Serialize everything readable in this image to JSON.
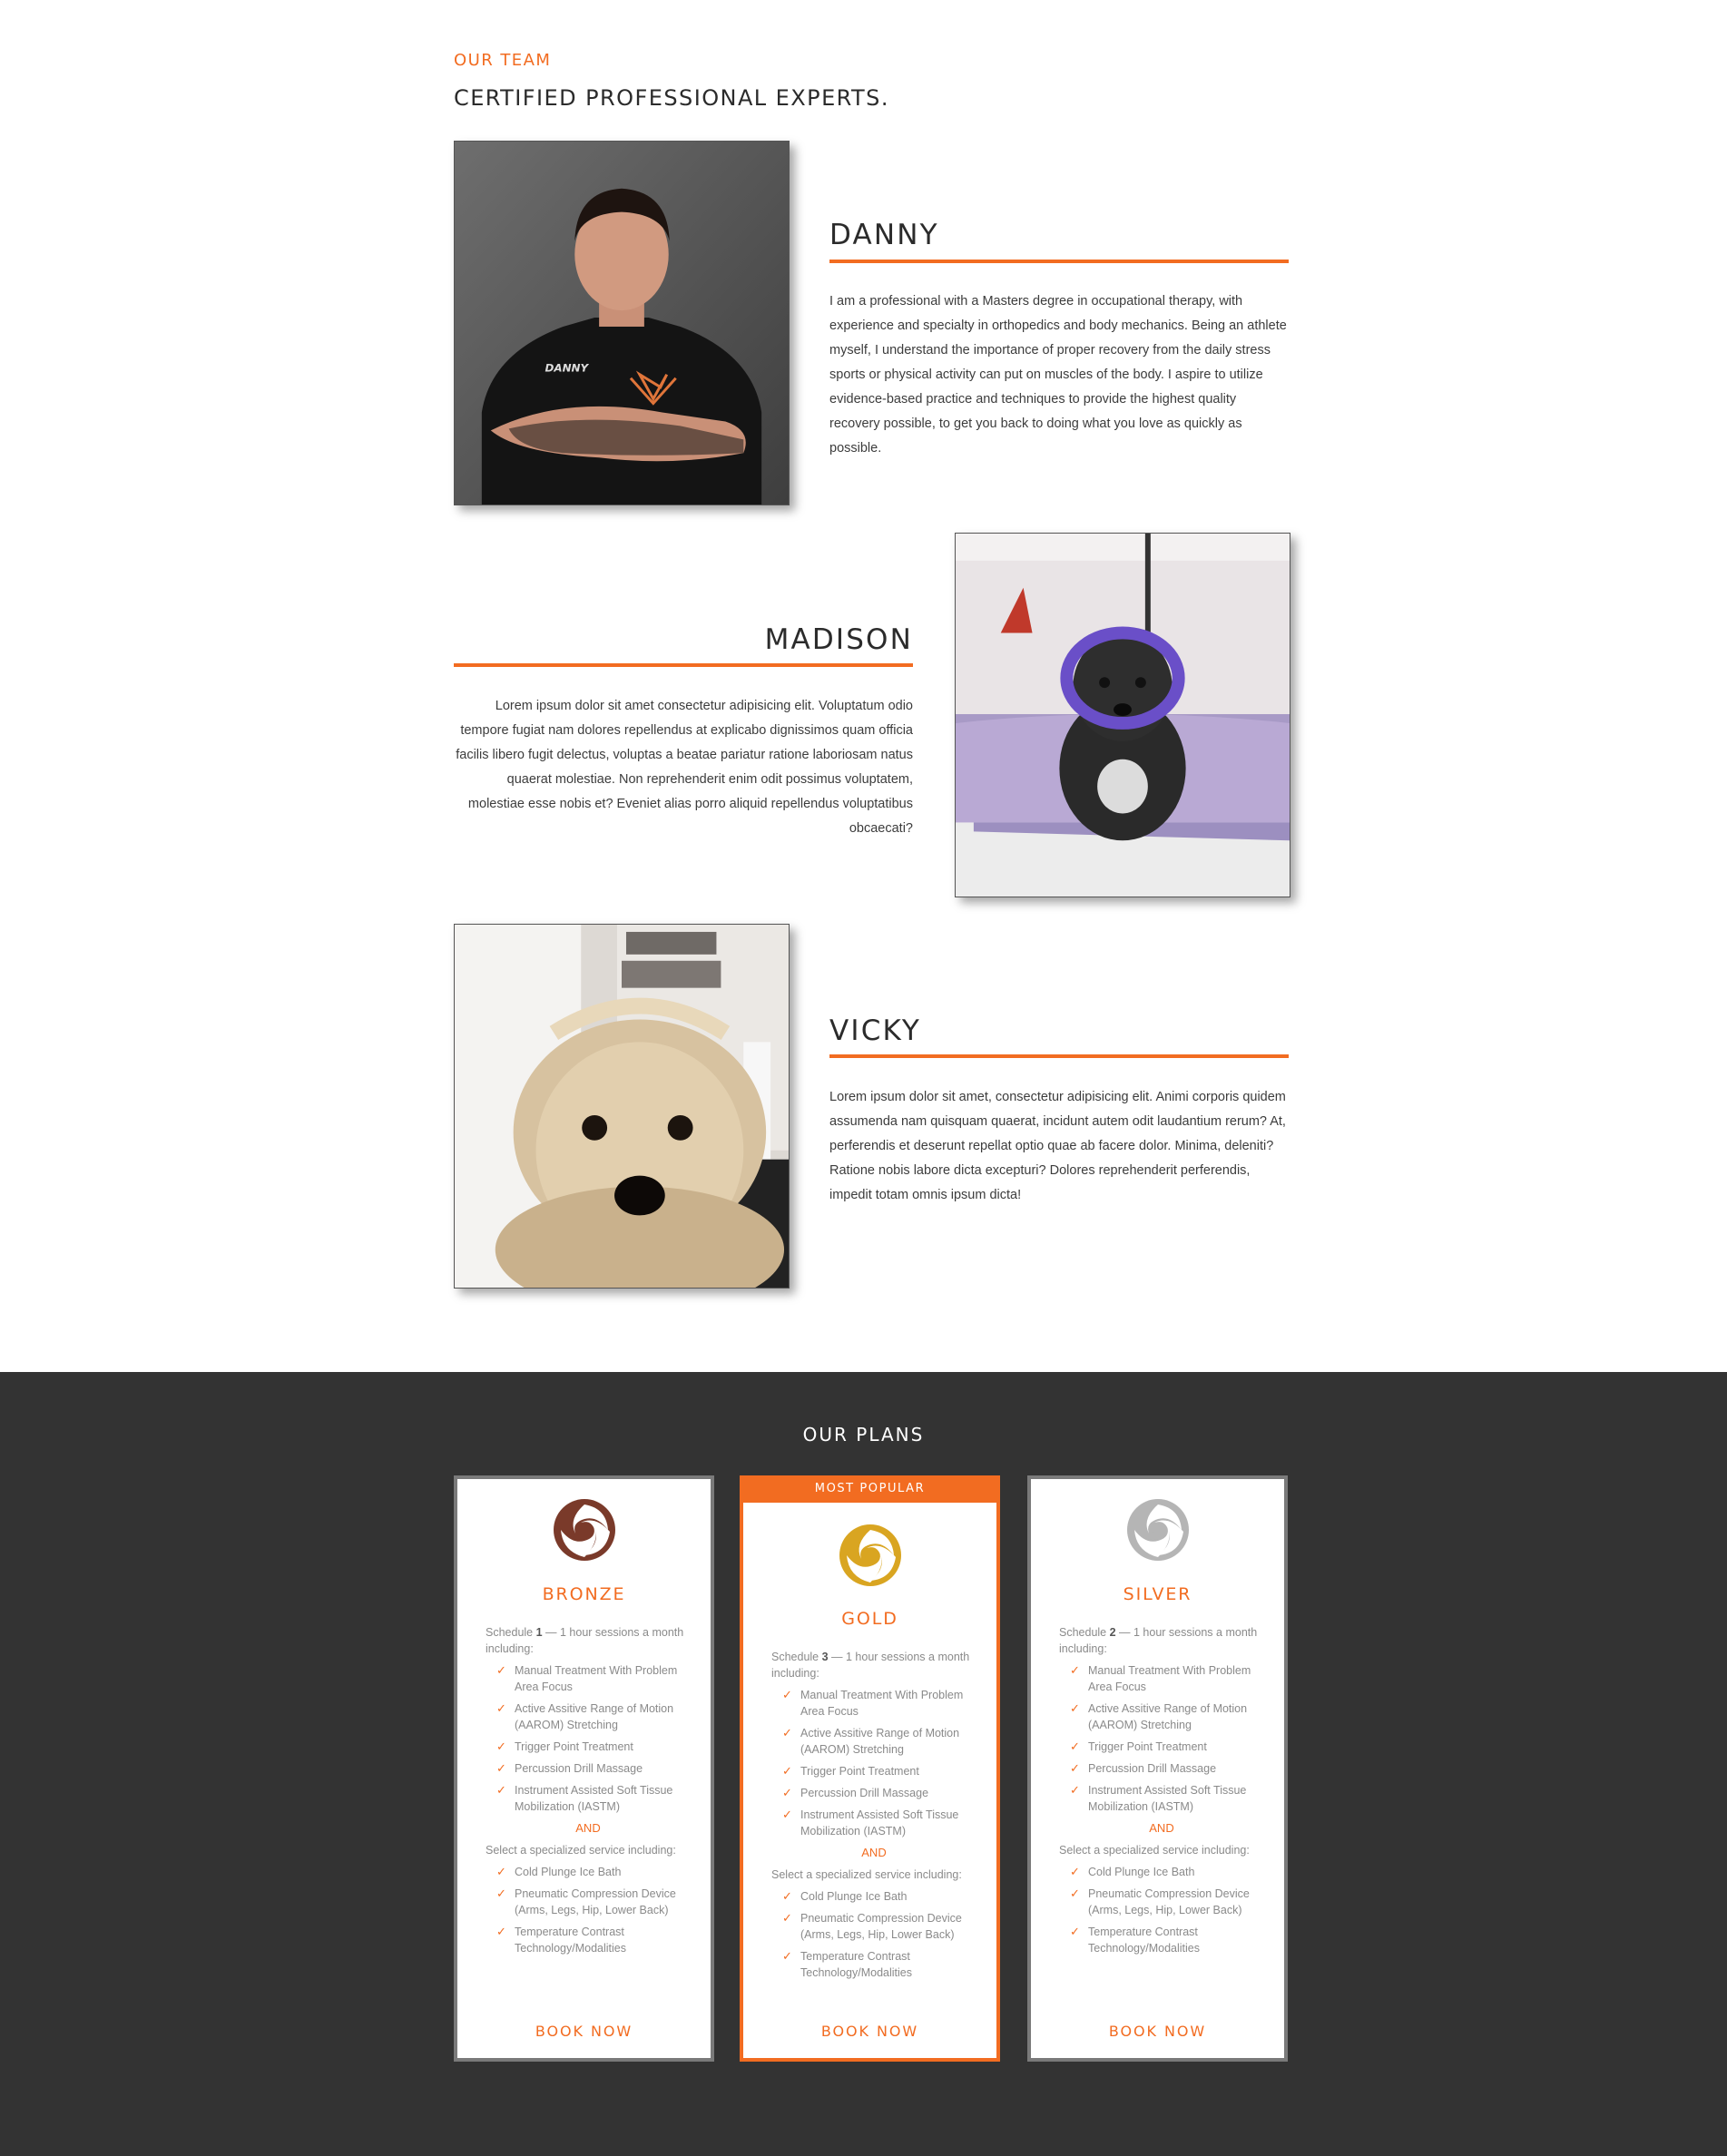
{
  "team": {
    "eyebrow": "OUR TEAM",
    "title": "CERTIFIED PROFESSIONAL EXPERTS.",
    "members": [
      {
        "name": "DANNY",
        "shirt_text": "DANNY",
        "bio": "I am a professional with a Masters degree in occupational therapy, with experience and specialty in orthopedics and body mechanics. Being an athlete myself, I understand the importance of proper recovery from the daily stress sports or physical activity can put on muscles of the body. I aspire to utilize evidence-based practice and techniques to provide the highest quality recovery possible, to get you back to doing what you love as quickly as possible."
      },
      {
        "name": "MADISON",
        "bio": "Lorem ipsum dolor sit amet consectetur adipisicing elit. Voluptatum odio tempore fugiat nam dolores repellendus at explicabo dignissimos quam officia facilis libero fugit delectus, voluptas a beatae pariatur ratione laboriosam natus quaerat molestiae. Non reprehenderit enim odit possimus voluptatem, molestiae esse nobis et? Eveniet alias porro aliquid repellendus voluptatibus obcaecati?"
      },
      {
        "name": "VICKY",
        "bio": "Lorem ipsum dolor sit amet, consectetur adipisicing elit. Animi corporis quidem assumenda nam quisquam quaerat, incidunt autem odit laudantium rerum? At, perferendis et deserunt repellat optio quae ab facere dolor. Minima, deleniti? Ratione nobis labore dicta excepturi? Dolores reprehenderit perferendis, impedit totam omnis ipsum dicta!"
      }
    ]
  },
  "plans": {
    "title": "OUR PLANS",
    "popular_label": "MOST POPULAR",
    "and_label": "AND",
    "select_label": "Select a specialized service including:",
    "book_label": "BOOK NOW",
    "schedule_prefix": "Schedule ",
    "schedule_suffix": " — 1 hour sessions a month including:",
    "colors": {
      "accent": "#f26c21",
      "bronze": "#7a3a2a",
      "gold": "#d9a521",
      "silver": "#b5b5b5",
      "dark_bg": "#333333"
    },
    "cards": [
      {
        "name": "BRONZE",
        "sessions": "1",
        "features": [
          "Manual Treatment With Problem Area Focus",
          "Active Assitive Range of Motion (AAROM) Stretching",
          "Trigger Point Treatment",
          "Percussion Drill Massage",
          "Instrument Assisted Soft Tissue Mobilization (IASTM)"
        ],
        "specials": [
          "Cold Plunge Ice Bath",
          "Pneumatic Compression Device (Arms, Legs, Hip, Lower Back)",
          "Temperature Contrast Technology/Modalities"
        ]
      },
      {
        "name": "GOLD",
        "sessions": "3",
        "features": [
          "Manual Treatment With Problem Area Focus",
          "Active Assitive Range of Motion (AAROM) Stretching",
          "Trigger Point Treatment",
          "Percussion Drill Massage",
          "Instrument Assisted Soft Tissue Mobilization (IASTM)"
        ],
        "specials": [
          "Cold Plunge Ice Bath",
          "Pneumatic Compression Device (Arms, Legs, Hip, Lower Back)",
          "Temperature Contrast Technology/Modalities"
        ]
      },
      {
        "name": "SILVER",
        "sessions": "2",
        "features": [
          "Manual Treatment With Problem Area Focus",
          "Active Assitive Range of Motion (AAROM) Stretching",
          "Trigger Point Treatment",
          "Percussion Drill Massage",
          "Instrument Assisted Soft Tissue Mobilization (IASTM)"
        ],
        "specials": [
          "Cold Plunge Ice Bath",
          "Pneumatic Compression Device (Arms, Legs, Hip, Lower Back)",
          "Temperature Contrast Technology/Modalities"
        ]
      }
    ]
  }
}
